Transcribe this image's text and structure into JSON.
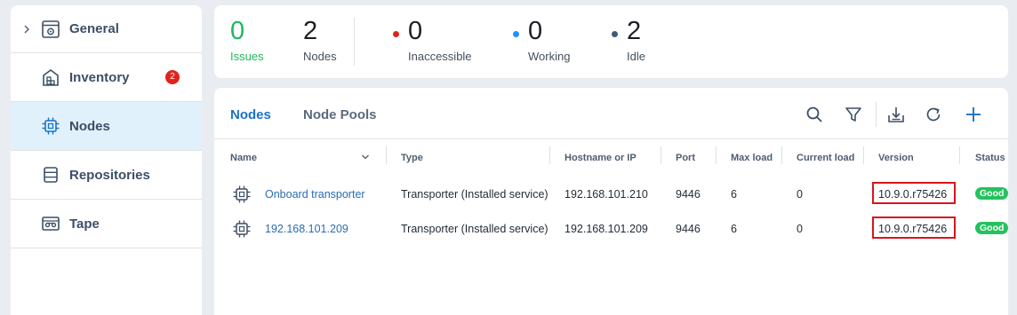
{
  "sidebar": {
    "items": [
      {
        "label": "General",
        "icon": "settings-window-icon"
      },
      {
        "label": "Inventory",
        "icon": "inventory-icon",
        "badge": "2"
      },
      {
        "label": "Nodes",
        "icon": "chip-icon",
        "active": true
      },
      {
        "label": "Repositories",
        "icon": "repository-icon"
      },
      {
        "label": "Tape",
        "icon": "tape-icon"
      }
    ]
  },
  "summary": {
    "issues": {
      "value": "0",
      "label": "Issues"
    },
    "nodes": {
      "value": "2",
      "label": "Nodes"
    },
    "inaccessible": {
      "value": "0",
      "label": "Inaccessible",
      "color": "#e0241b"
    },
    "working": {
      "value": "0",
      "label": "Working",
      "color": "#1e90ff"
    },
    "idle": {
      "value": "2",
      "label": "Idle",
      "color": "#3f5a7a"
    }
  },
  "tabs": [
    {
      "label": "Nodes",
      "active": true
    },
    {
      "label": "Node Pools",
      "active": false
    }
  ],
  "toolbar": [
    "search-icon",
    "filter-icon",
    "export-icon",
    "refresh-icon",
    "add-icon"
  ],
  "table": {
    "columns": [
      "Name",
      "Type",
      "Hostname or IP",
      "Port",
      "Max load",
      "Current load",
      "Version",
      "Status"
    ],
    "rows": [
      {
        "name": "Onboard transporter",
        "type": "Transporter (Installed service)",
        "hostname": "192.168.101.210",
        "port": "9446",
        "max_load": "6",
        "current_load": "0",
        "version": "10.9.0.r75426",
        "status": "Good"
      },
      {
        "name": "192.168.101.209",
        "type": "Transporter (Installed service)",
        "hostname": "192.168.101.209",
        "port": "9446",
        "max_load": "6",
        "current_load": "0",
        "version": "10.9.0.r75426",
        "status": "Good"
      }
    ]
  },
  "colors": {
    "accent": "#1a73c7",
    "good": "#24c25d",
    "highlight_border": "#d9141b",
    "active_nav_bg": "#e1f1fb"
  }
}
